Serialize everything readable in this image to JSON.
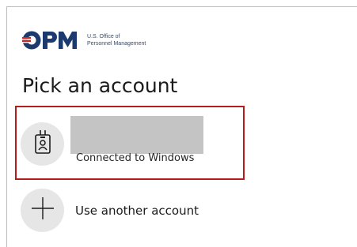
{
  "brand": {
    "logo_letters": "OPM",
    "name_line1": "U.S. Office of",
    "name_line2": "Personnel Management",
    "primary_color": "#1d3a6e",
    "accent_color": "#c62828"
  },
  "heading": "Pick an account",
  "accounts": [
    {
      "status": "Connected to Windows",
      "icon": "badge-icon",
      "selected": true,
      "highlight_color": "#b71c1c"
    }
  ],
  "other_option": {
    "label": "Use another account",
    "icon": "plus-icon"
  }
}
